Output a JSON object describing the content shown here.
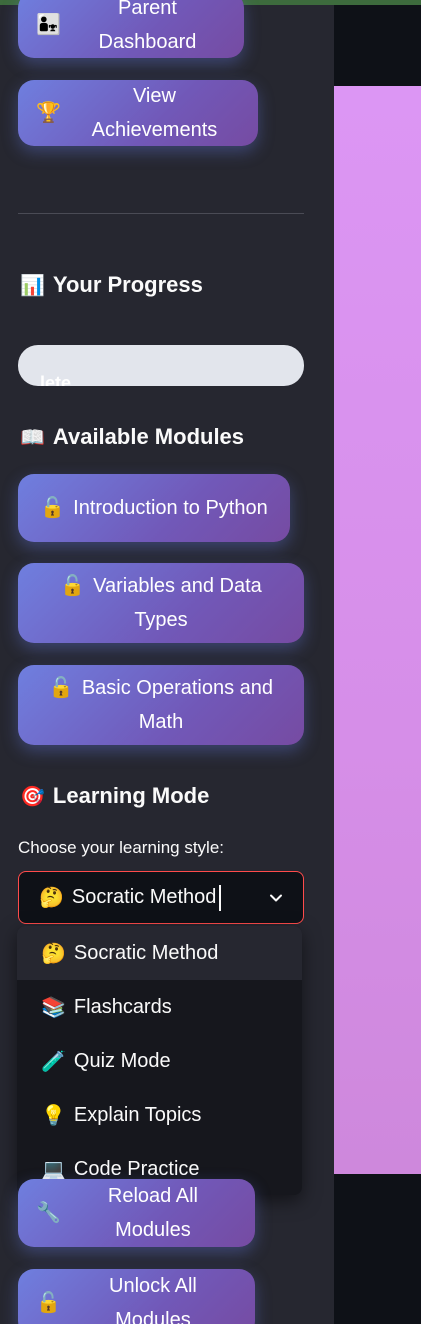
{
  "sidebar": {
    "nav_buttons": [
      {
        "emoji": "👨‍👧",
        "label": "Parent Dashboard"
      },
      {
        "emoji": "🏆",
        "label": "View Achievements"
      }
    ],
    "progress_section": {
      "emoji": "📊",
      "title": "Your Progress",
      "progress_text": "lete",
      "fill_fraction": 0
    },
    "modules_section": {
      "emoji": "📖",
      "title": "Available Modules",
      "modules": [
        {
          "emoji": "🔓",
          "label_line1": "Introduction to Python",
          "label_line2": ""
        },
        {
          "emoji": "🔓",
          "label_line1": "Variables and Data",
          "label_line2": "Types"
        },
        {
          "emoji": "🔓",
          "label_line1": "Basic Operations and",
          "label_line2": "Math"
        }
      ]
    },
    "learning_mode": {
      "emoji": "🎯",
      "title": "Learning Mode",
      "select_label": "Choose your learning style:",
      "selected": {
        "emoji": "🤔",
        "label": "Socratic Method"
      },
      "options": [
        {
          "emoji": "🤔",
          "label": "Socratic Method"
        },
        {
          "emoji": "📚",
          "label": "Flashcards"
        },
        {
          "emoji": "🧪",
          "label": "Quiz Mode"
        },
        {
          "emoji": "💡",
          "label": "Explain Topics"
        },
        {
          "emoji": "💻",
          "label": "Code Practice"
        }
      ]
    },
    "admin_buttons": [
      {
        "emoji": "🔧",
        "label": "Reload All Modules"
      },
      {
        "emoji": "🔓",
        "label": "Unlock All Modules"
      }
    ]
  },
  "colors": {
    "sidebar_bg": "#262730",
    "app_bg": "#0e1117",
    "accent_gradient_start": "#667eea",
    "accent_gradient_end": "#764ba2",
    "select_border": "#ff4b4b",
    "main_panel": "#dc96f4"
  },
  "icons": {
    "select_chevron": "chevron-down-icon"
  }
}
